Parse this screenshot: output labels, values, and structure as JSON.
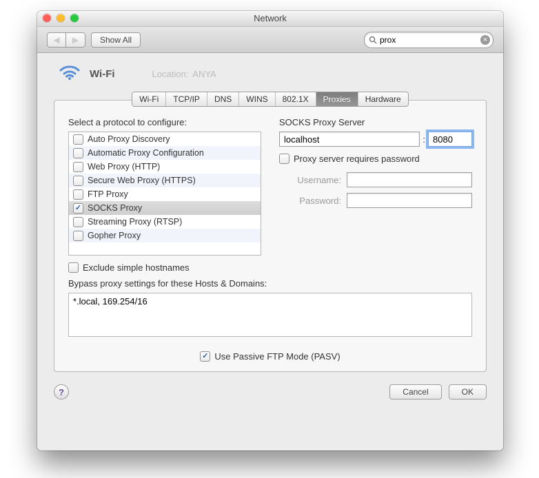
{
  "title": "Network",
  "traffic_light_colors": {
    "close": "#ff5f57",
    "min": "#febc2e",
    "zoom": "#28c840"
  },
  "toolbar": {
    "back_icon": "◀",
    "forward_icon": "▶",
    "show_all": "Show All",
    "search_value": "prox",
    "clear_glyph": "×"
  },
  "header": {
    "connection_name": "Wi-Fi",
    "ghost_label": "Location:",
    "ghost_value": "ANYA"
  },
  "tabs": [
    "Wi-Fi",
    "TCP/IP",
    "DNS",
    "WINS",
    "802.1X",
    "Proxies",
    "Hardware"
  ],
  "active_tab_index": 5,
  "left": {
    "label": "Select a protocol to configure:",
    "protocols": [
      {
        "label": "Auto Proxy Discovery",
        "checked": false
      },
      {
        "label": "Automatic Proxy Configuration",
        "checked": false
      },
      {
        "label": "Web Proxy (HTTP)",
        "checked": false
      },
      {
        "label": "Secure Web Proxy (HTTPS)",
        "checked": false
      },
      {
        "label": "FTP Proxy",
        "checked": false
      },
      {
        "label": "SOCKS Proxy",
        "checked": true,
        "selected": true
      },
      {
        "label": "Streaming Proxy (RTSP)",
        "checked": false
      },
      {
        "label": "Gopher Proxy",
        "checked": false
      }
    ]
  },
  "right": {
    "title": "SOCKS Proxy Server",
    "host": "localhost",
    "port_sep": ":",
    "port": "8080",
    "auth_checkbox": "Proxy server requires password",
    "username_label": "Username:",
    "password_label": "Password:",
    "username": "",
    "password": ""
  },
  "exclude": {
    "checkbox": "Exclude simple hostnames",
    "checked": false,
    "bypass_label": "Bypass proxy settings for these Hosts & Domains:",
    "bypass_value": "*.local, 169.254/16"
  },
  "pasv": {
    "label": "Use Passive FTP Mode (PASV)",
    "checked": true
  },
  "footer": {
    "cancel": "Cancel",
    "ok": "OK",
    "help_glyph": "?"
  }
}
